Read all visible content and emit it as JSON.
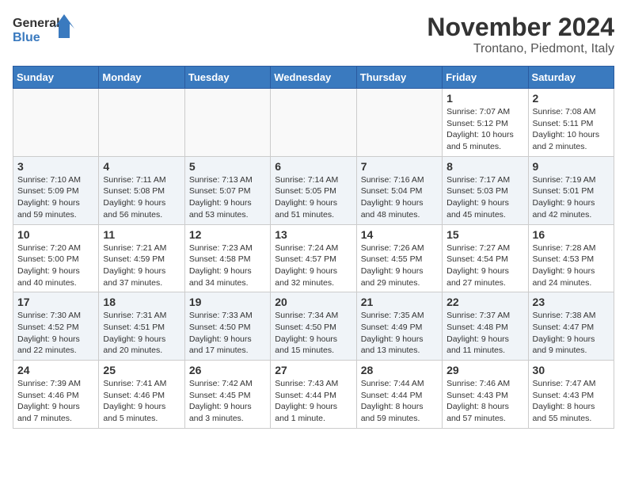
{
  "logo": {
    "line1": "General",
    "line2": "Blue"
  },
  "title": "November 2024",
  "location": "Trontano, Piedmont, Italy",
  "weekdays": [
    "Sunday",
    "Monday",
    "Tuesday",
    "Wednesday",
    "Thursday",
    "Friday",
    "Saturday"
  ],
  "weeks": [
    [
      {
        "day": "",
        "info": ""
      },
      {
        "day": "",
        "info": ""
      },
      {
        "day": "",
        "info": ""
      },
      {
        "day": "",
        "info": ""
      },
      {
        "day": "",
        "info": ""
      },
      {
        "day": "1",
        "info": "Sunrise: 7:07 AM\nSunset: 5:12 PM\nDaylight: 10 hours and 5 minutes."
      },
      {
        "day": "2",
        "info": "Sunrise: 7:08 AM\nSunset: 5:11 PM\nDaylight: 10 hours and 2 minutes."
      }
    ],
    [
      {
        "day": "3",
        "info": "Sunrise: 7:10 AM\nSunset: 5:09 PM\nDaylight: 9 hours and 59 minutes."
      },
      {
        "day": "4",
        "info": "Sunrise: 7:11 AM\nSunset: 5:08 PM\nDaylight: 9 hours and 56 minutes."
      },
      {
        "day": "5",
        "info": "Sunrise: 7:13 AM\nSunset: 5:07 PM\nDaylight: 9 hours and 53 minutes."
      },
      {
        "day": "6",
        "info": "Sunrise: 7:14 AM\nSunset: 5:05 PM\nDaylight: 9 hours and 51 minutes."
      },
      {
        "day": "7",
        "info": "Sunrise: 7:16 AM\nSunset: 5:04 PM\nDaylight: 9 hours and 48 minutes."
      },
      {
        "day": "8",
        "info": "Sunrise: 7:17 AM\nSunset: 5:03 PM\nDaylight: 9 hours and 45 minutes."
      },
      {
        "day": "9",
        "info": "Sunrise: 7:19 AM\nSunset: 5:01 PM\nDaylight: 9 hours and 42 minutes."
      }
    ],
    [
      {
        "day": "10",
        "info": "Sunrise: 7:20 AM\nSunset: 5:00 PM\nDaylight: 9 hours and 40 minutes."
      },
      {
        "day": "11",
        "info": "Sunrise: 7:21 AM\nSunset: 4:59 PM\nDaylight: 9 hours and 37 minutes."
      },
      {
        "day": "12",
        "info": "Sunrise: 7:23 AM\nSunset: 4:58 PM\nDaylight: 9 hours and 34 minutes."
      },
      {
        "day": "13",
        "info": "Sunrise: 7:24 AM\nSunset: 4:57 PM\nDaylight: 9 hours and 32 minutes."
      },
      {
        "day": "14",
        "info": "Sunrise: 7:26 AM\nSunset: 4:55 PM\nDaylight: 9 hours and 29 minutes."
      },
      {
        "day": "15",
        "info": "Sunrise: 7:27 AM\nSunset: 4:54 PM\nDaylight: 9 hours and 27 minutes."
      },
      {
        "day": "16",
        "info": "Sunrise: 7:28 AM\nSunset: 4:53 PM\nDaylight: 9 hours and 24 minutes."
      }
    ],
    [
      {
        "day": "17",
        "info": "Sunrise: 7:30 AM\nSunset: 4:52 PM\nDaylight: 9 hours and 22 minutes."
      },
      {
        "day": "18",
        "info": "Sunrise: 7:31 AM\nSunset: 4:51 PM\nDaylight: 9 hours and 20 minutes."
      },
      {
        "day": "19",
        "info": "Sunrise: 7:33 AM\nSunset: 4:50 PM\nDaylight: 9 hours and 17 minutes."
      },
      {
        "day": "20",
        "info": "Sunrise: 7:34 AM\nSunset: 4:50 PM\nDaylight: 9 hours and 15 minutes."
      },
      {
        "day": "21",
        "info": "Sunrise: 7:35 AM\nSunset: 4:49 PM\nDaylight: 9 hours and 13 minutes."
      },
      {
        "day": "22",
        "info": "Sunrise: 7:37 AM\nSunset: 4:48 PM\nDaylight: 9 hours and 11 minutes."
      },
      {
        "day": "23",
        "info": "Sunrise: 7:38 AM\nSunset: 4:47 PM\nDaylight: 9 hours and 9 minutes."
      }
    ],
    [
      {
        "day": "24",
        "info": "Sunrise: 7:39 AM\nSunset: 4:46 PM\nDaylight: 9 hours and 7 minutes."
      },
      {
        "day": "25",
        "info": "Sunrise: 7:41 AM\nSunset: 4:46 PM\nDaylight: 9 hours and 5 minutes."
      },
      {
        "day": "26",
        "info": "Sunrise: 7:42 AM\nSunset: 4:45 PM\nDaylight: 9 hours and 3 minutes."
      },
      {
        "day": "27",
        "info": "Sunrise: 7:43 AM\nSunset: 4:44 PM\nDaylight: 9 hours and 1 minute."
      },
      {
        "day": "28",
        "info": "Sunrise: 7:44 AM\nSunset: 4:44 PM\nDaylight: 8 hours and 59 minutes."
      },
      {
        "day": "29",
        "info": "Sunrise: 7:46 AM\nSunset: 4:43 PM\nDaylight: 8 hours and 57 minutes."
      },
      {
        "day": "30",
        "info": "Sunrise: 7:47 AM\nSunset: 4:43 PM\nDaylight: 8 hours and 55 minutes."
      }
    ]
  ]
}
